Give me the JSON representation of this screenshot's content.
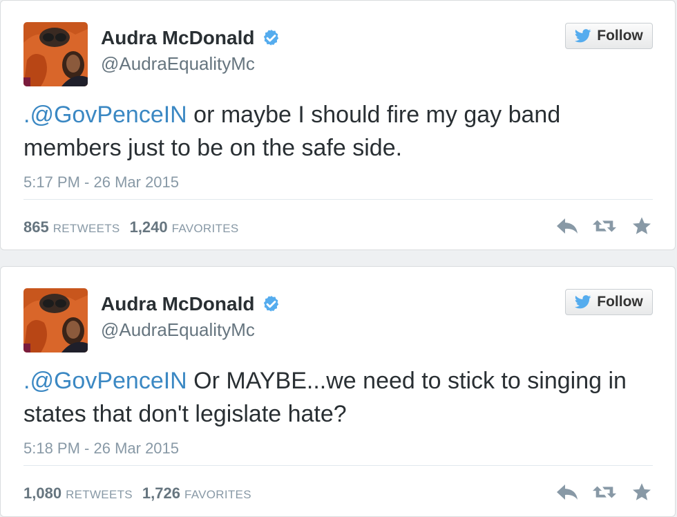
{
  "colors": {
    "accent_link": "#3b88c3",
    "verified_blue": "#55acee",
    "action_icon": "#8899a6"
  },
  "tweets": [
    {
      "author_name": "Audra McDonald",
      "author_handle": "@AudraEqualityMc",
      "verified_icon": "verified-badge-icon",
      "follow_label": "Follow",
      "mention": ".@GovPenceIN",
      "text_rest": " or maybe I should fire my gay band members just to be on the safe side.",
      "timestamp": "5:17 PM - 26 Mar 2015",
      "retweets_count": "865",
      "retweets_label": "RETWEETS",
      "favorites_count": "1,240",
      "favorites_label": "FAVORITES",
      "actions": [
        "reply-icon",
        "retweet-icon",
        "favorite-star-icon"
      ]
    },
    {
      "author_name": "Audra McDonald",
      "author_handle": "@AudraEqualityMc",
      "verified_icon": "verified-badge-icon",
      "follow_label": "Follow",
      "mention": ".@GovPenceIN",
      "text_rest": " Or MAYBE...we need to stick to singing in states that don't legislate hate?",
      "timestamp": "5:18 PM - 26 Mar 2015",
      "retweets_count": "1,080",
      "retweets_label": "RETWEETS",
      "favorites_count": "1,726",
      "favorites_label": "FAVORITES",
      "actions": [
        "reply-icon",
        "retweet-icon",
        "favorite-star-icon"
      ]
    }
  ]
}
